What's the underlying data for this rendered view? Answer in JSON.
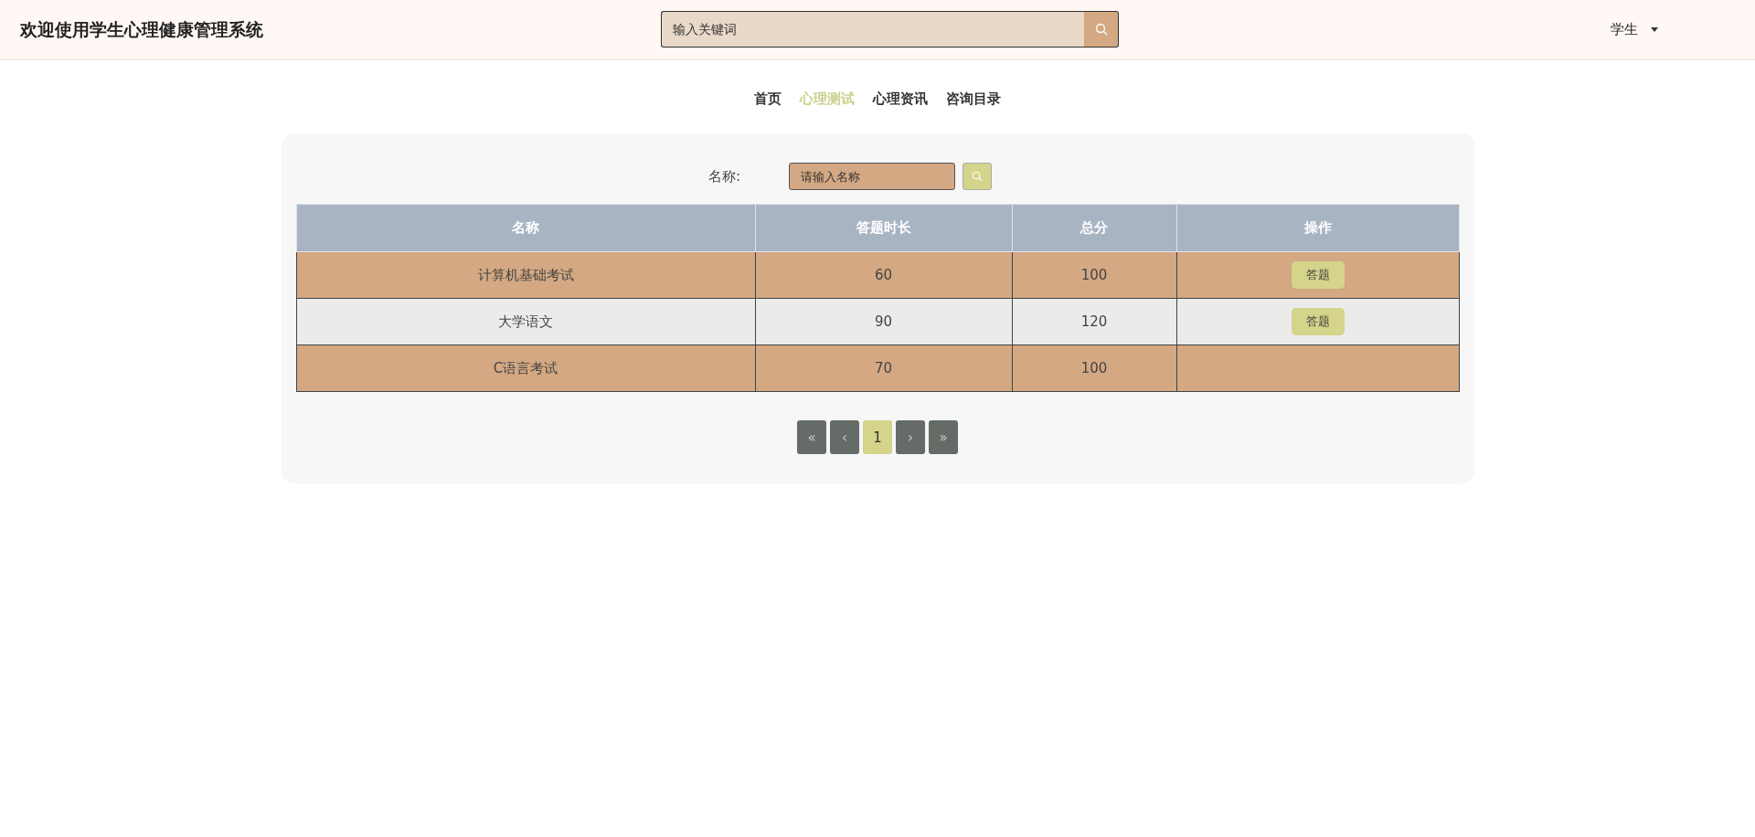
{
  "header": {
    "title": "欢迎使用学生心理健康管理系统",
    "search": {
      "placeholder": "输入关键词"
    },
    "user": {
      "label": "学生"
    }
  },
  "nav": [
    {
      "label": "首页",
      "selected": false
    },
    {
      "label": "心理测试",
      "selected": true
    },
    {
      "label": "心理资讯",
      "selected": false
    },
    {
      "label": "咨询目录",
      "selected": false
    }
  ],
  "filter": {
    "label": "名称:",
    "placeholder": "请输入名称"
  },
  "table": {
    "columns": [
      "名称",
      "答题时长",
      "总分",
      "操作"
    ],
    "rows": [
      {
        "name": "计算机基础考试",
        "duration": "60",
        "score": "100",
        "action": "答题"
      },
      {
        "name": "大学语文",
        "duration": "90",
        "score": "120",
        "action": "答题"
      },
      {
        "name": "C语言考试",
        "duration": "70",
        "score": "100"
      }
    ]
  },
  "pagination": [
    {
      "label": "«",
      "selected": false
    },
    {
      "label": "‹",
      "selected": false
    },
    {
      "label": "1",
      "selected": true
    },
    {
      "label": "›",
      "selected": false
    },
    {
      "label": "»",
      "selected": false
    }
  ]
}
